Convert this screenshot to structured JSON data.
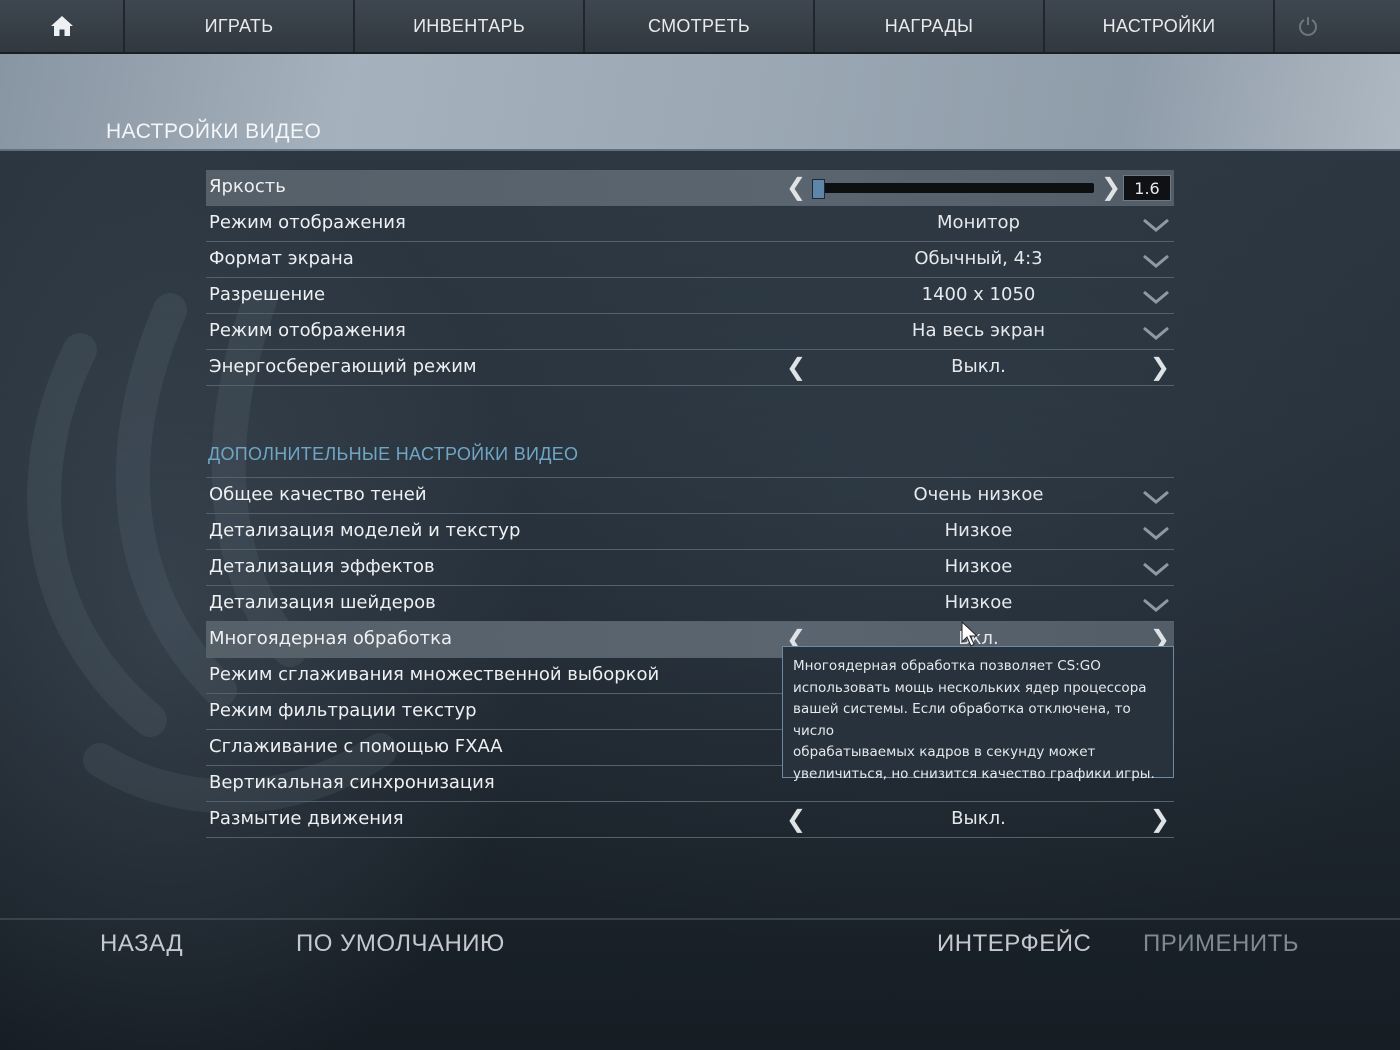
{
  "nav": {
    "home_icon": "home-icon",
    "tabs": [
      {
        "label": "ИГРАТЬ"
      },
      {
        "label": "ИНВЕНТАРЬ"
      },
      {
        "label": "СМОТРЕТЬ"
      },
      {
        "label": "НАГРАДЫ"
      },
      {
        "label": "НАСТРОЙКИ"
      }
    ],
    "power_icon": "power-icon"
  },
  "header": {
    "title": "НАСТРОЙКИ ВИДЕО"
  },
  "basic": {
    "brightness": {
      "label": "Яркость",
      "value": "1.6",
      "slider_fraction": 0.0
    },
    "rows": [
      {
        "label": "Режим отображения",
        "value": "Монитор"
      },
      {
        "label": "Формат экрана",
        "value": "Обычный, 4:3"
      },
      {
        "label": "Разрешение",
        "value": "1400 x 1050"
      },
      {
        "label": "Режим отображения",
        "value": "На весь экран"
      }
    ],
    "power_saving": {
      "label": "Энергосберегающий режим",
      "value": "Выкл."
    }
  },
  "advanced": {
    "title": "ДОПОЛНИТЕЛЬНЫЕ НАСТРОЙКИ ВИДЕО",
    "rows": [
      {
        "label": "Общее качество теней",
        "value": "Очень низкое"
      },
      {
        "label": "Детализация моделей и текстур",
        "value": "Низкое"
      },
      {
        "label": "Детализация эффектов",
        "value": "Низкое"
      },
      {
        "label": "Детализация шейдеров",
        "value": "Низкое"
      }
    ],
    "multicore": {
      "label": "Многоядерная обработка",
      "value": "Вкл."
    },
    "covered_rows": [
      {
        "label": "Режим сглаживания множественной выборкой"
      },
      {
        "label": "Режим фильтрации текстур"
      },
      {
        "label": "Сглаживание с помощью FXAA"
      },
      {
        "label": "Вертикальная синхронизация"
      }
    ],
    "motion_blur": {
      "label": "Размытие движения",
      "value": "Выкл."
    }
  },
  "tooltip": {
    "lines": [
      "Многоядерная обработка позволяет CS:GO",
      "использовать мощь нескольких ядер процессора",
      "вашей системы. Если обработка отключена, то число",
      "обрабатываемых кадров в секунду может",
      "увеличиться, но снизится качество графики игры."
    ]
  },
  "footer": {
    "back": "НАЗАД",
    "defaults": "ПО УМОЛЧАНИЮ",
    "interface": "ИНТЕРФЕЙС",
    "apply": "ПРИМЕНИТЬ"
  },
  "colors": {
    "accent_section": "#6fa6c4",
    "footer_text": "#c3c9cf",
    "footer_disabled": "#7f8992"
  }
}
